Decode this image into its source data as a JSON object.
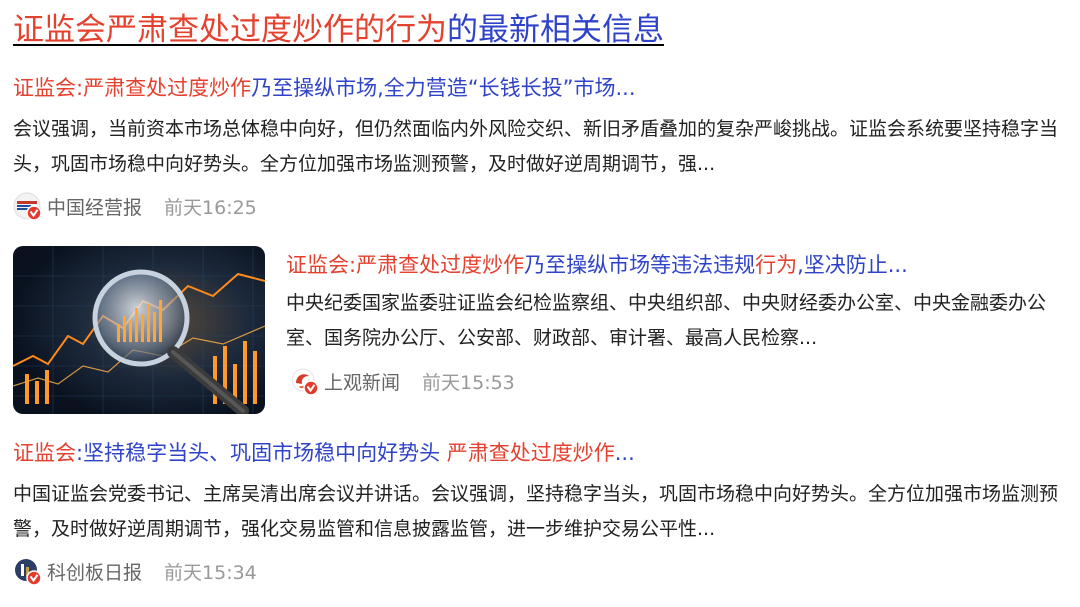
{
  "title": {
    "highlight": "证监会严肃查处过度炒作的行为",
    "rest": "的最新相关信息"
  },
  "items": [
    {
      "title_parts": [
        {
          "text": "证监会:严肃查处过度炒作",
          "hl": true
        },
        {
          "text": "乃至操纵市场,全力营造“长钱长投”市场...",
          "hl": false
        }
      ],
      "desc": "会议强调，当前资本市场总体稳中向好，但仍然面临内外风险交织、新旧矛盾叠加的复杂严峻挑战。证监会系统要坚持稳字当头，巩固市场稳中向好势头。全方位加强市场监测预警，及时做好逆周期调节，强...",
      "source": "中国经营报",
      "time": "前天16:25",
      "icon": "cbj-logo-icon"
    },
    {
      "title_parts": [
        {
          "text": "证监会:严肃查处过度炒作",
          "hl": true
        },
        {
          "text": "乃至操纵市场等违法违规",
          "hl": false
        },
        {
          "text": "行为",
          "hl": true
        },
        {
          "text": ",坚决防止...",
          "hl": false
        }
      ],
      "desc": "中央纪委国家监委驻证监会纪检监察组、中央组织部、中央财经委办公室、中央金融委办公室、国务院办公厅、公安部、财政部、审计署、最高人民检察...",
      "source": "上观新闻",
      "time": "前天15:53",
      "icon": "shobserver-logo-icon",
      "thumbnail": "magnifier-stock-chart-image"
    },
    {
      "title_parts": [
        {
          "text": "证监会",
          "hl": true
        },
        {
          "text": ":坚持稳字当头、巩固市场稳中向好势头 ",
          "hl": false
        },
        {
          "text": "严肃查处过度炒作",
          "hl": true
        },
        {
          "text": "...",
          "hl": false
        }
      ],
      "desc": "中国证监会党委书记、主席吴清出席会议并讲话。会议强调，坚持稳字当头，巩固市场稳中向好势头。全方位加强市场监测预警，及时做好逆周期调节，强化交易监管和信息披露监管，进一步维护交易公平性...",
      "source": "科创板日报",
      "time": "前天15:34",
      "icon": "star-market-daily-logo-icon"
    }
  ],
  "colors": {
    "highlight": "#e5412f",
    "link": "#2f43c8",
    "text": "#222222",
    "source": "#666666",
    "time": "#999999",
    "verified_badge": "#e23b2e"
  }
}
